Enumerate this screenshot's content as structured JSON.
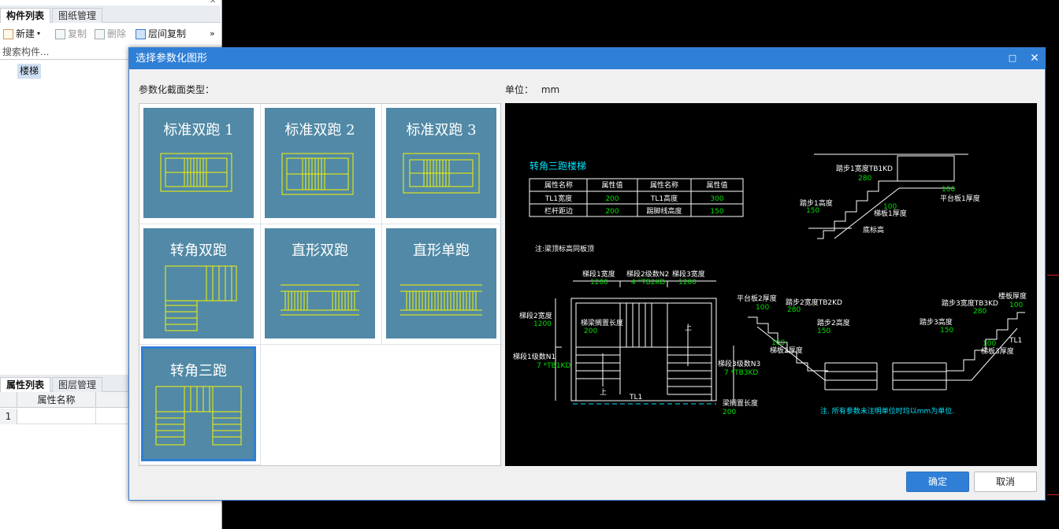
{
  "left_panel": {
    "top_tabs": [
      "构件列表",
      "图纸管理"
    ],
    "toolbar": {
      "new_label": "新建",
      "copy_label": "复制",
      "delete_label": "删除",
      "floor_copy_label": "层间复制",
      "more_label": "»"
    },
    "search_placeholder": "搜索构件...",
    "tree_item": "楼梯",
    "bottom_tabs": [
      "属性列表",
      "图层管理"
    ],
    "grid_header": "属性名称",
    "grid_row_num": "1"
  },
  "dialog": {
    "title": "选择参数化图形",
    "section_label": "参数化截面类型：",
    "unit_label": "单位：",
    "unit_value": "mm",
    "ok_label": "确定",
    "cancel_label": "取消",
    "tiles": [
      {
        "label": "标准双跑 1",
        "selected": false
      },
      {
        "label": "标准双跑 2",
        "selected": false
      },
      {
        "label": "标准双跑 3",
        "selected": false
      },
      {
        "label": "转角双跑",
        "selected": false
      },
      {
        "label": "直形双跑",
        "selected": false
      },
      {
        "label": "直形单跑",
        "selected": false
      },
      {
        "label": "转角三跑",
        "selected": true
      }
    ]
  },
  "preview": {
    "title": "转角三跑楼梯",
    "table_headers": [
      "属性名称",
      "属性值",
      "属性名称",
      "属性值"
    ],
    "table_rows": [
      [
        "TL1宽度",
        "200",
        "TL1高度",
        "300"
      ],
      [
        "栏杆距边",
        "200",
        "踢脚线高度",
        "150"
      ]
    ],
    "note1": "注:梁顶标高同板顶",
    "note2": "注. 所有参数未注明单位时均以mm为单位.",
    "labels": {
      "step1_width": "踏步1宽度TB1KD",
      "step1_width_val": "280",
      "slab1_thick": "平台板1厚度",
      "slab1_thick_val": "100",
      "step1_height": "踏步1高度",
      "step1_height_val": "150",
      "stair_slab1_thick": "梯板1厚度",
      "stair_slab1_thick_val": "100",
      "bottom_elev": "底标高",
      "run1_width": "梯段1宽度",
      "run1_width_val": "1200",
      "run2_steps": "梯段2级数N2",
      "run2_steps_val": "4 *TB2KD",
      "run3_width": "梯段3宽度",
      "run3_width_val": "1200",
      "run2_width": "梯段2宽度",
      "run2_width_val": "1200",
      "beam_len": "梯梁搁置长度",
      "beam_len_val": "200",
      "up": "上",
      "run1_steps": "梯段1级数N1",
      "run1_steps_val": "7 *TB1KD",
      "run3_steps": "梯段3级数N3",
      "run3_steps_val": "7 *TB3KD",
      "tl1": "TL1",
      "beam_len2": "梁搁置长度",
      "beam_len2_val": "200",
      "slab2_thick": "平台板2厚度",
      "slab2_thick_val": "100",
      "step2_width": "踏步2宽度TB2KD",
      "step2_width_val": "280",
      "step2_height": "踏步2高度",
      "step2_height_val": "150",
      "stair_slab2_thick": "梯板2厚度",
      "stair_slab2_thick_val": "100",
      "step3_width": "踏步3宽度TB3KD",
      "step3_width_val": "280",
      "slab_thick": "楼板厚度",
      "slab_thick_val": "100",
      "step3_height": "踏步3高度",
      "step3_height_val": "150",
      "stair_slab3_thick": "梯板3厚度",
      "stair_slab3_thick_val": "100"
    }
  },
  "colors": {
    "titlebar": "#2f7fd6",
    "thumb_bg": "#5189a6",
    "cad_line": "#ffffff",
    "cad_value": "#00e000",
    "cad_title": "#00e5ff",
    "thumb_line": "#f5f500"
  }
}
